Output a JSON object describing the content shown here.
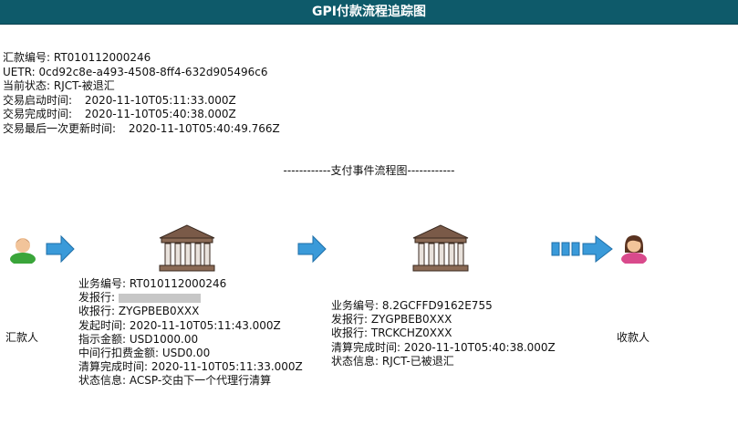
{
  "title": "GPI付款流程追踪图",
  "info": {
    "remit_no": {
      "label": "汇款编号:",
      "value": "RT010112000246"
    },
    "uetr": {
      "label": "UETR:",
      "value": "0cd92c8e-a493-4508-8ff4-632d905496c6"
    },
    "status": {
      "label": "当前状态:",
      "value": "RJCT-被退汇"
    },
    "start_time": {
      "label": "交易启动时间:",
      "value": "2020-11-10T05:11:33.000Z"
    },
    "complete_time": {
      "label": "交易完成时间:",
      "value": "2020-11-10T05:40:38.000Z"
    },
    "last_update": {
      "label": "交易最后一次更新时间:",
      "value": "2020-11-10T05:40:49.766Z"
    }
  },
  "flow_title": "------------支付事件流程图------------",
  "remitter_label": "汇款人",
  "payee_label": "收款人",
  "event1": {
    "business_no": {
      "label": "业务编号:",
      "value": "RT010112000246"
    },
    "sender": {
      "label": "发报行:",
      "value": ""
    },
    "receiver": {
      "label": "收报行:",
      "value": "ZYGPBEB0XXX"
    },
    "send_time": {
      "label": "发起时间:",
      "value": "2020-11-10T05:11:43.000Z"
    },
    "amount": {
      "label": "指示金额:",
      "value": "USD1000.00"
    },
    "fee": {
      "label": "中间行扣费金额:",
      "value": "USD0.00"
    },
    "clear_time": {
      "label": "清算完成时间:",
      "value": "2020-11-10T05:11:33.000Z"
    },
    "status": {
      "label": "状态信息:",
      "value": "ACSP-交由下一个代理行清算"
    }
  },
  "event2": {
    "business_no": {
      "label": "业务编号:",
      "value": "8.2GCFFD9162E755"
    },
    "sender": {
      "label": "发报行:",
      "value": "ZYGPBEB0XXX"
    },
    "receiver": {
      "label": "收报行:",
      "value": "TRCKCHZ0XXX"
    },
    "clear_time": {
      "label": "清算完成时间:",
      "value": "2020-11-10T05:40:38.000Z"
    },
    "status": {
      "label": "状态信息:",
      "value": "RJCT-已被退汇"
    }
  },
  "icons": {
    "remitter": "male-user-icon",
    "payee": "female-user-icon",
    "bank": "bank-building-icon",
    "arrow": "right-arrow-icon",
    "multi_arrow": "multi-step-arrow-icon"
  },
  "colors": {
    "title_bar": "#0e5a6a",
    "arrow": "#3a9ad9",
    "bank": "#8a6a55"
  }
}
